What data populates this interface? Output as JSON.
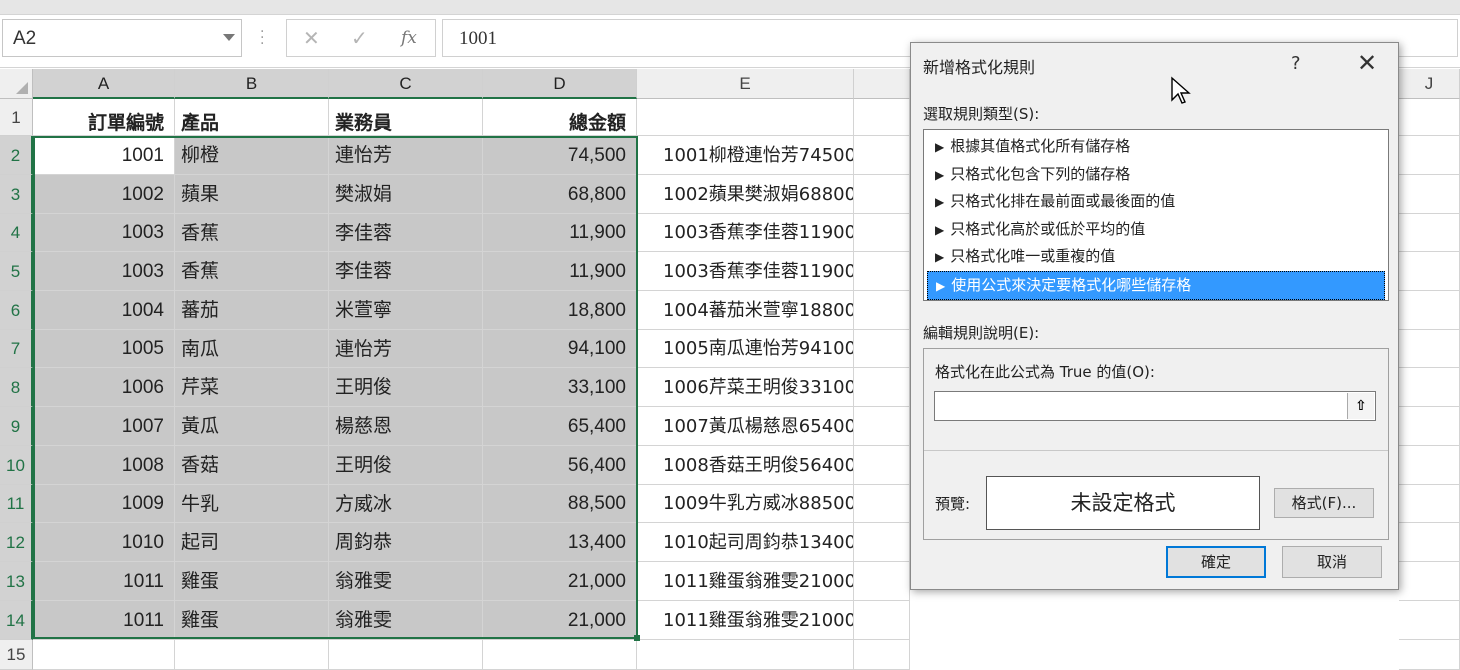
{
  "name_box": {
    "value": "A2"
  },
  "formula_bar": {
    "fx": "fx",
    "value": "1001"
  },
  "columns": [
    "A",
    "B",
    "C",
    "D",
    "E",
    "J"
  ],
  "row_numbers": [
    "1",
    "2",
    "3",
    "4",
    "5",
    "6",
    "7",
    "8",
    "9",
    "10",
    "11",
    "12",
    "13",
    "14",
    "15"
  ],
  "header": {
    "a": "訂單編號",
    "b": "產品",
    "c": "業務員",
    "d": "總金額"
  },
  "rows": [
    {
      "a": "1001",
      "b": "柳橙",
      "c": "連怡芳",
      "d": "74,500",
      "e": "1001柳橙連怡芳74500"
    },
    {
      "a": "1002",
      "b": "蘋果",
      "c": "樊淑娟",
      "d": "68,800",
      "e": "1002蘋果樊淑娟68800"
    },
    {
      "a": "1003",
      "b": "香蕉",
      "c": "李佳蓉",
      "d": "11,900",
      "e": "1003香蕉李佳蓉11900"
    },
    {
      "a": "1003",
      "b": "香蕉",
      "c": "李佳蓉",
      "d": "11,900",
      "e": "1003香蕉李佳蓉11900"
    },
    {
      "a": "1004",
      "b": "蕃茄",
      "c": "米萱寧",
      "d": "18,800",
      "e": "1004蕃茄米萱寧18800"
    },
    {
      "a": "1005",
      "b": "南瓜",
      "c": "連怡芳",
      "d": "94,100",
      "e": "1005南瓜連怡芳94100"
    },
    {
      "a": "1006",
      "b": "芹菜",
      "c": "王明俊",
      "d": "33,100",
      "e": "1006芹菜王明俊33100"
    },
    {
      "a": "1007",
      "b": "黃瓜",
      "c": "楊慈恩",
      "d": "65,400",
      "e": "1007黃瓜楊慈恩65400"
    },
    {
      "a": "1008",
      "b": "香菇",
      "c": "王明俊",
      "d": "56,400",
      "e": "1008香菇王明俊56400"
    },
    {
      "a": "1009",
      "b": "牛乳",
      "c": "方威冰",
      "d": "88,500",
      "e": "1009牛乳方威冰88500"
    },
    {
      "a": "1010",
      "b": "起司",
      "c": "周鈞恭",
      "d": "13,400",
      "e": "1010起司周鈞恭13400"
    },
    {
      "a": "1011",
      "b": "雞蛋",
      "c": "翁雅雯",
      "d": "21,000",
      "e": "1011雞蛋翁雅雯21000"
    },
    {
      "a": "1011",
      "b": "雞蛋",
      "c": "翁雅雯",
      "d": "21,000",
      "e": "1011雞蛋翁雅雯21000"
    }
  ],
  "dialog": {
    "title": "新增格式化規則",
    "help": "?",
    "close": "✕",
    "select_rule_label": "選取規則類型(S):",
    "rule_types": [
      "根據其值格式化所有儲存格",
      "只格式化包含下列的儲存格",
      "只格式化排在最前面或最後面的值",
      "只格式化高於或低於平均的值",
      "只格式化唯一或重複的值",
      "使用公式來決定要格式化哪些儲存格"
    ],
    "selected_rule_index": 5,
    "edit_rule_label": "編輯規則說明(E):",
    "formula_label": "格式化在此公式為 True 的值(O):",
    "formula_value": "",
    "preview_label": "預覽:",
    "preview_text": "未設定格式",
    "format_button": "格式(F)...",
    "ok_button": "確定",
    "cancel_button": "取消"
  }
}
